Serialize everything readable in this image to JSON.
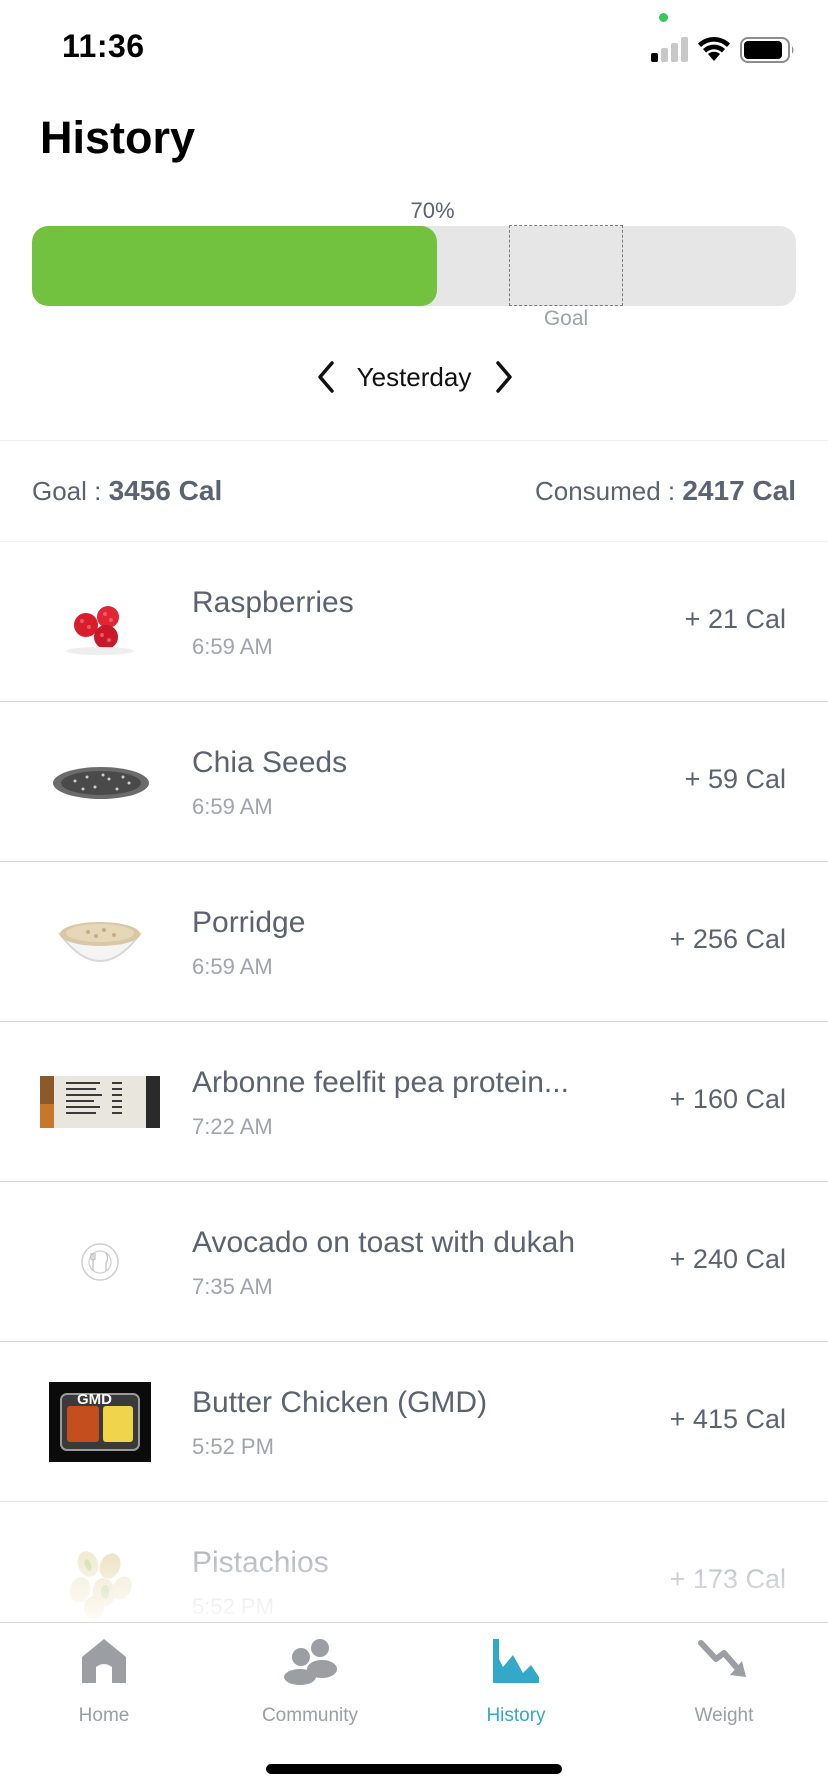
{
  "status_bar": {
    "time": "11:36"
  },
  "page": {
    "title": "History"
  },
  "progress": {
    "percent_label": "70%",
    "fill_fraction": 0.53,
    "goal_label": "Goal"
  },
  "day_nav": {
    "label": "Yesterday"
  },
  "summary": {
    "goal_prefix": "Goal : ",
    "goal_value": "3456 Cal",
    "consumed_prefix": "Consumed : ",
    "consumed_value": "2417 Cal"
  },
  "foods": [
    {
      "name": "Raspberries",
      "time": "6:59 AM",
      "calories": "+ 21 Cal",
      "icon": "raspberry-icon"
    },
    {
      "name": "Chia Seeds",
      "time": "6:59 AM",
      "calories": "+ 59 Cal",
      "icon": "chia-seeds-icon"
    },
    {
      "name": "Porridge",
      "time": "6:59 AM",
      "calories": "+ 256 Cal",
      "icon": "porridge-bowl-icon"
    },
    {
      "name": "Arbonne feelfit pea protein...",
      "time": "7:22 AM",
      "calories": "+ 160 Cal",
      "icon": "nutrition-label-photo"
    },
    {
      "name": "Avocado on toast with dukah",
      "time": "7:35 AM",
      "calories": "+ 240 Cal",
      "icon": "plate-placeholder-icon"
    },
    {
      "name": "Butter Chicken (GMD)",
      "time": "5:52 PM",
      "calories": "+ 415 Cal",
      "icon": "meal-pack-photo",
      "pack_logo": "GMD"
    },
    {
      "name": "Pistachios",
      "time": "5:52 PM",
      "calories": "+ 173 Cal",
      "icon": "pistachio-icon"
    }
  ],
  "tabs": [
    {
      "label": "Home",
      "icon": "home-icon",
      "active": false
    },
    {
      "label": "Community",
      "icon": "community-icon",
      "active": false
    },
    {
      "label": "History",
      "icon": "history-chart-icon",
      "active": true
    },
    {
      "label": "Weight",
      "icon": "weight-trend-icon",
      "active": false
    }
  ],
  "colors": {
    "progress_fill": "#72c23f",
    "active_tab": "#33a9c7",
    "inactive_tab": "#9b9ea3",
    "text": "#5b6270"
  }
}
